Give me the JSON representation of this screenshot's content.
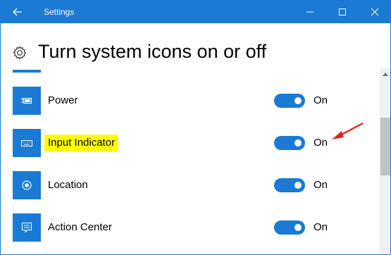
{
  "window": {
    "title": "Settings",
    "accent_color": "#1a7ad4"
  },
  "titlebar": {
    "back_icon": "arrow-left-icon",
    "minimize_icon": "minimize-icon",
    "maximize_icon": "maximize-icon",
    "close_icon": "close-icon"
  },
  "header": {
    "icon": "gear-icon",
    "title": "Turn system icons on or off"
  },
  "items": [
    {
      "label": "Power",
      "icon": "battery-icon",
      "state": "On",
      "on": true,
      "highlighted": false
    },
    {
      "label": "Input Indicator",
      "icon": "keyboard-icon",
      "state": "On",
      "on": true,
      "highlighted": true
    },
    {
      "label": "Location",
      "icon": "location-icon",
      "state": "On",
      "on": true,
      "highlighted": false
    },
    {
      "label": "Action Center",
      "icon": "action-center-icon",
      "state": "On",
      "on": true,
      "highlighted": false
    }
  ],
  "annotation": {
    "arrow_color": "#e8201c",
    "highlight_color": "#ffff00"
  }
}
